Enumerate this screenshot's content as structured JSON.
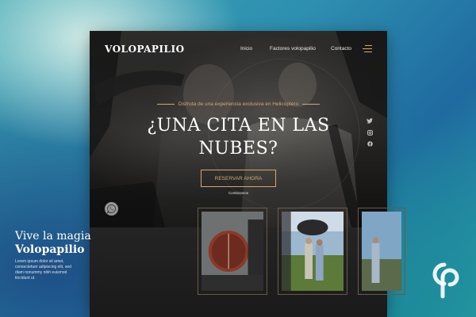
{
  "header": {
    "logo": "VOLOPAPILIO",
    "nav": [
      "Inicio",
      "Factores volopapilio",
      "Contacto"
    ]
  },
  "hero": {
    "tagline": "Disfruta de una experiencia exclusiva en Helicóptero",
    "headline_line1": "¿UNA CITA EN LAS",
    "headline_line2": "NUBES?",
    "cta": "RESERVAR AHORA",
    "contact": "Contáctanos"
  },
  "social": [
    "twitter-icon",
    "instagram-icon",
    "facebook-icon",
    "whatsapp-icon"
  ],
  "section": {
    "title_line1": "Vive la magia",
    "title_line2": "Volopapilio",
    "body": "Lorem ipsum dolor sit amet, consectetuer adipiscing elit, sed diam nonummy nibh euismod tincidunt ut."
  },
  "colors": {
    "accent": "#d8a86a",
    "background": "#151515"
  }
}
